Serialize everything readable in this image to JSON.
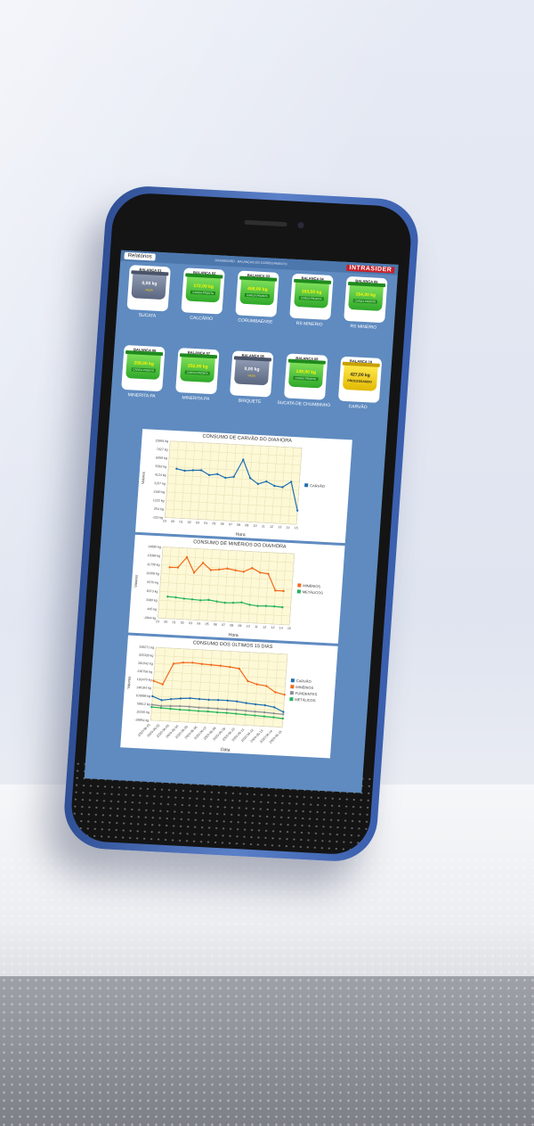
{
  "header": {
    "reports_button": "Relatórios",
    "system_title": "DASHBOARD - BALANÇAS DO CARREGAMENTO",
    "brand": "INTRASIDER"
  },
  "scales": [
    {
      "name": "BALANÇA 01",
      "weight": "0,00 kg",
      "status": "VAZIA",
      "state": "gray",
      "material": "SUCATA"
    },
    {
      "name": "BALANÇA 02",
      "weight": "172,00 kg",
      "status": "CARGA PRONTA",
      "state": "green",
      "material": "CALCÁRIO"
    },
    {
      "name": "BALANÇA 03",
      "weight": "458,00 kg",
      "status": "CARGA PRONTA",
      "state": "green",
      "material": "CORUMBAENSE"
    },
    {
      "name": "BALANÇA 04",
      "weight": "163,00 kg",
      "status": "CARGA PRONTA",
      "state": "green",
      "material": "RS MINERIO"
    },
    {
      "name": "BALANÇA 05",
      "weight": "164,00 kg",
      "status": "CARGA PRONTA",
      "state": "green",
      "material": "RS MINERIO"
    },
    {
      "name": "BALANÇA 06",
      "weight": "258,00 kg",
      "status": "CARGA PRONTA",
      "state": "green",
      "material": "MINERITA PA"
    },
    {
      "name": "BALANÇA 07",
      "weight": "252,00 kg",
      "status": "CARGA PRONTA",
      "state": "green",
      "material": "MINERITA PA"
    },
    {
      "name": "BALANÇA 08",
      "weight": "0,00 kg",
      "status": "VAZIA",
      "state": "gray",
      "material": "BRIQUETE"
    },
    {
      "name": "BALANÇA 09",
      "weight": "149,00 kg",
      "status": "CARGA PRONTA",
      "state": "green",
      "material": "SUCATA DE CHUMBINHO"
    },
    {
      "name": "BALANÇA 10",
      "weight": "427,00 kg",
      "status": "PROCESSANDO",
      "state": "yellow",
      "material": "CARVÃO"
    }
  ],
  "colors": {
    "carvao": "#1f6fb2",
    "minerios": "#f06a1c",
    "metalicos": "#22b35a",
    "fundentes": "#8a8f99",
    "plot_bg": "#fdf8d6"
  },
  "chart_data": [
    {
      "type": "line",
      "title": "CONSUMO DE CARVÃO DO DIA/HORA",
      "xlabel": "Hora",
      "ylabel": "Valores",
      "y_ticks": [
        "-315 kg",
        "254 kg",
        "1222 kg",
        "2190 kg",
        "3157 kg",
        "4124 kg",
        "5092 kg",
        "6059 kg",
        "7027 kg",
        "15994 kg"
      ],
      "ylim": [
        -315,
        7500
      ],
      "categories": [
        "23",
        "00",
        "01",
        "02",
        "03",
        "04",
        "05",
        "06",
        "07",
        "08",
        "09",
        "10",
        "11",
        "12",
        "13",
        "14",
        "15"
      ],
      "series": [
        {
          "name": "CARVÃO",
          "values": [
            null,
            4710,
            4560,
            4650,
            4700,
            4250,
            4390,
            4050,
            4200,
            5994,
            4160,
            3600,
            3900,
            3500,
            3400,
            4000,
            1100
          ]
        }
      ],
      "legend": "right"
    },
    {
      "type": "line",
      "title": "CONSUMO DE MINÉRIOS DO DIA/HORA",
      "xlabel": "Hora",
      "ylabel": "Valores",
      "y_ticks": [
        "-2844 kg",
        "445 kg",
        "3380 kg",
        "6073 kg",
        "9370 kg",
        "10309 kg",
        "11709 kg",
        "13098 kg",
        "14990 kg"
      ],
      "ylim": [
        -2844,
        15500
      ],
      "categories": [
        "23",
        "00",
        "01",
        "02",
        "03",
        "04",
        "05",
        "06",
        "07",
        "08",
        "09",
        "10",
        "11",
        "12",
        "13",
        "14",
        "15"
      ],
      "series": [
        {
          "name": "MINÉRIOS",
          "values": [
            null,
            10340,
            10410,
            13190,
            9300,
            11940,
            10200,
            10440,
            10800,
            10460,
            10200,
            11270,
            10200,
            10000,
            5800,
            5800,
            null
          ]
        },
        {
          "name": "METÁLICOS",
          "values": [
            null,
            2800,
            2700,
            2500,
            2400,
            2300,
            2500,
            2200,
            2000,
            2100,
            2300,
            1800,
            1600,
            1700,
            1700,
            1600,
            null
          ]
        }
      ],
      "legend": "right"
    },
    {
      "type": "line",
      "title": "CONSUMO DOS ÚLTIMOS 15 DIAS",
      "xlabel": "Data",
      "ylabel": "Valores",
      "y_ticks": [
        "-28954 kg",
        "15330 kg",
        "59612 kg",
        "103898 kg",
        "148184 kg",
        "192470 kg",
        "236756 kg",
        "281042 kg",
        "325328 kg",
        "349271 kg"
      ],
      "ylim": [
        -28954,
        349271
      ],
      "categories": [
        "2020-06-01",
        "2020-06-02",
        "2020-06-03",
        "2020-06-04",
        "2020-06-05",
        "2020-06-06",
        "2020-06-07",
        "2020-06-08",
        "2020-06-09",
        "2020-06-10",
        "2020-06-11",
        "2020-06-12",
        "2020-06-13",
        "2020-06-14",
        "2020-06-15"
      ],
      "series": [
        {
          "name": "CARVÃO",
          "values": [
            96000,
            78000,
            86000,
            92000,
            96000,
            94000,
            93000,
            94000,
            94000,
            92000,
            86000,
            82000,
            80000,
            72000,
            50000
          ]
        },
        {
          "name": "MINÉRIOS",
          "values": [
            176000,
            160000,
            270000,
            278000,
            280000,
            276000,
            274000,
            272000,
            268000,
            262000,
            200000,
            186000,
            180000,
            150000,
            140000
          ]
        },
        {
          "name": "FUNDENTES",
          "values": [
            52000,
            48000,
            50000,
            52000,
            52000,
            50000,
            50000,
            49000,
            48000,
            48000,
            46000,
            44000,
            43000,
            40000,
            38000
          ]
        },
        {
          "name": "METÁLICOS",
          "values": [
            40000,
            38000,
            36000,
            34000,
            34000,
            32000,
            32000,
            30000,
            30000,
            28000,
            26000,
            24000,
            22000,
            20000,
            16000
          ]
        }
      ],
      "legend": "right"
    }
  ]
}
